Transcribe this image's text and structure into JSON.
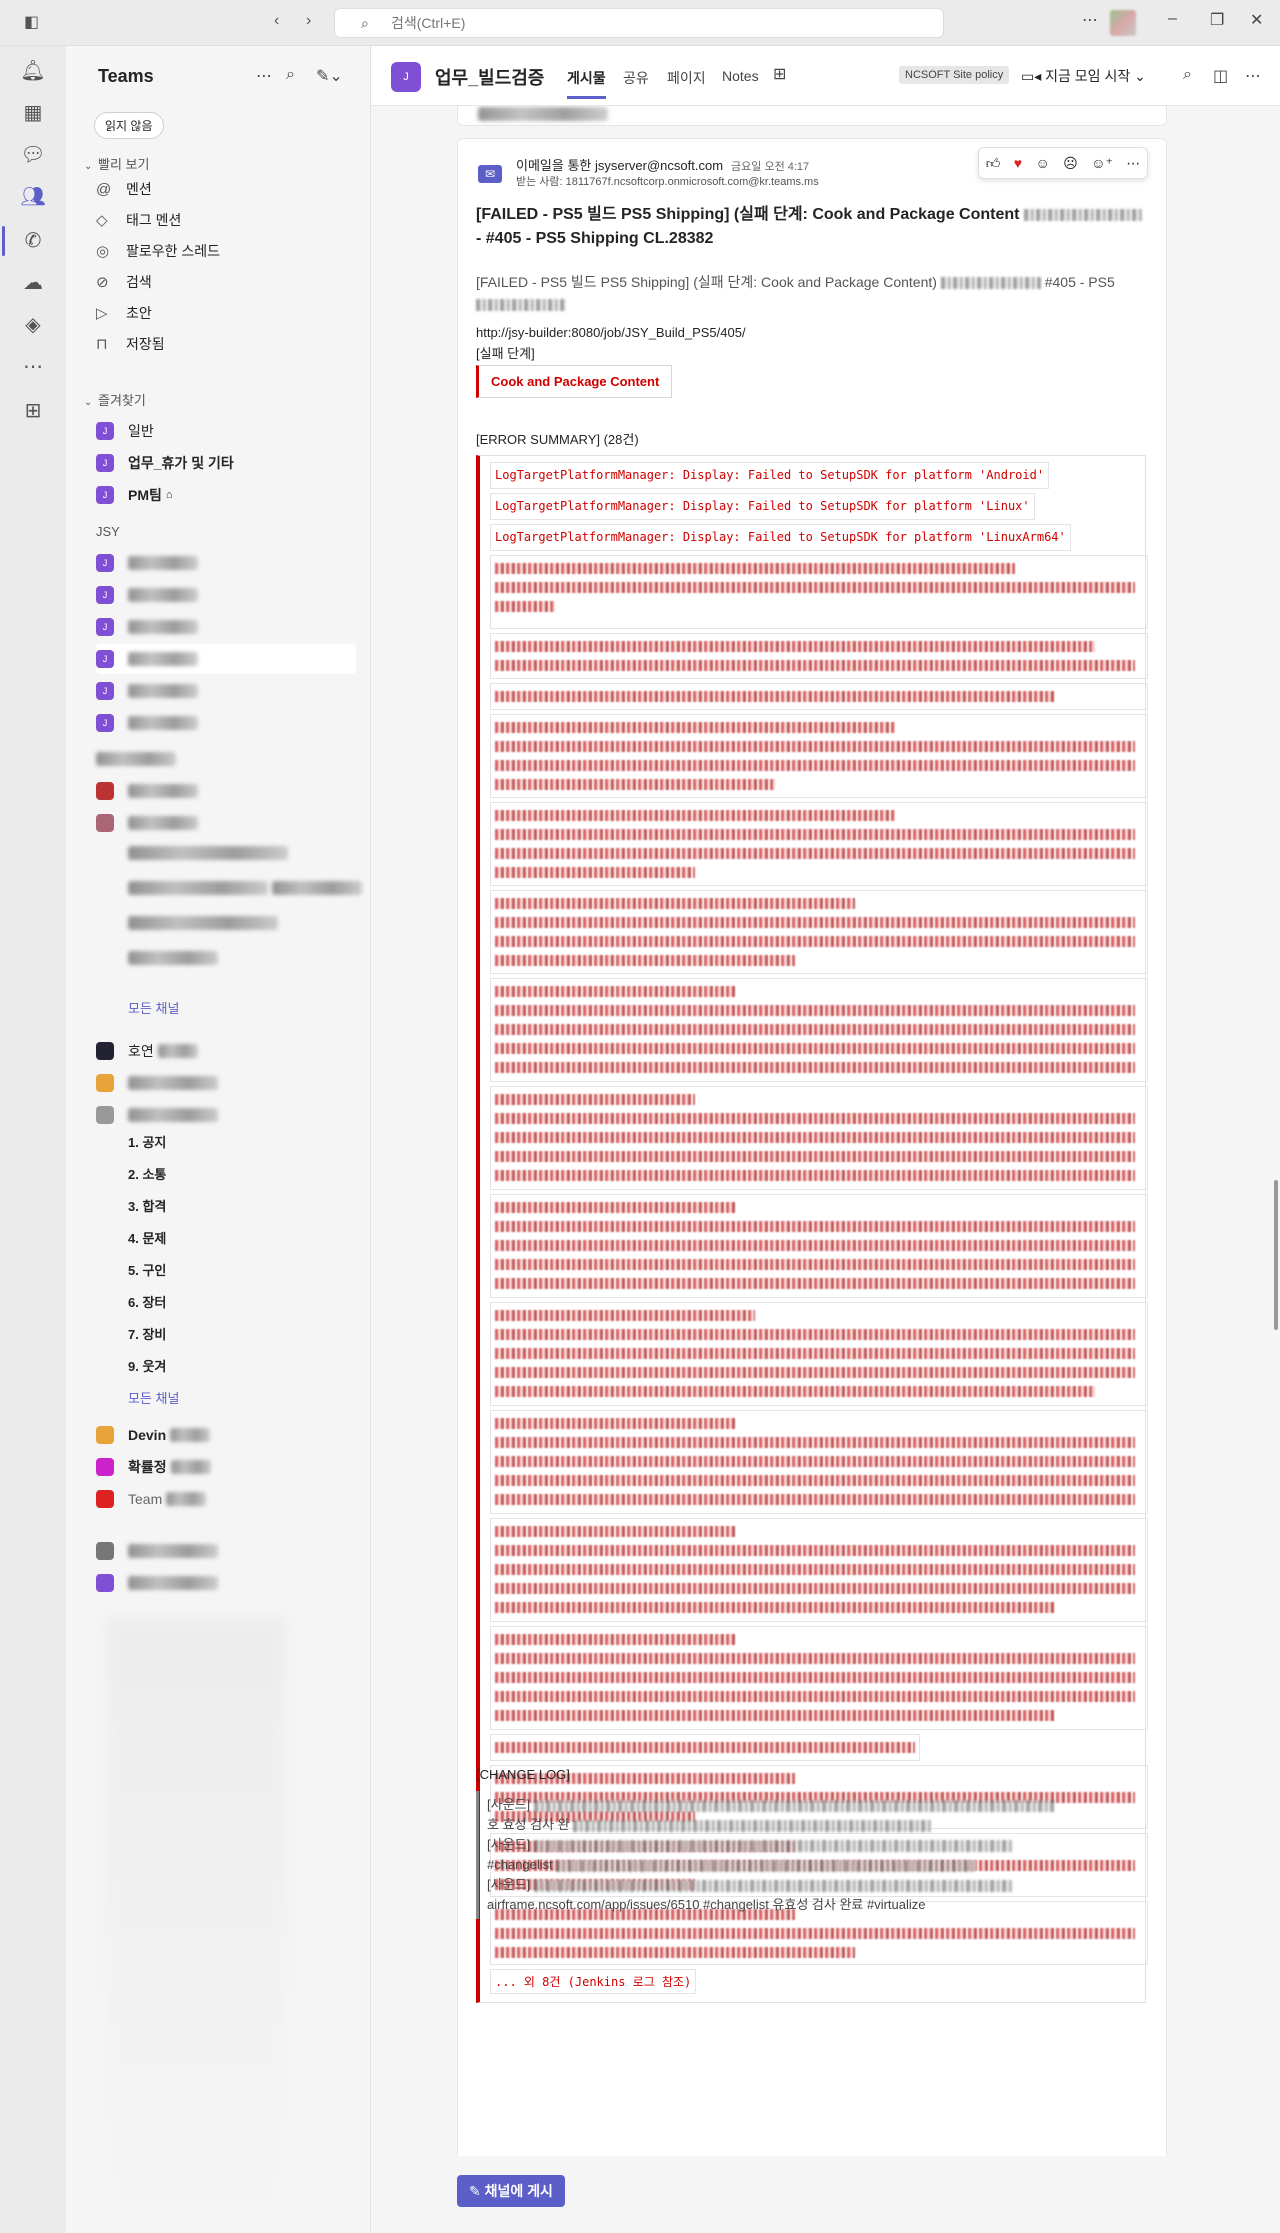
{
  "titlebar": {
    "search_placeholder": "검색(Ctrl+E)"
  },
  "sidebar": {
    "title": "Teams",
    "unread_filter": "읽지 않음",
    "quick_view": {
      "heading": "빨리 보기",
      "items": [
        {
          "label": "멘션",
          "icon": "at-icon"
        },
        {
          "label": "태그 멘션",
          "icon": "tag-icon"
        },
        {
          "label": "팔로우한 스레드",
          "icon": "thread-icon"
        },
        {
          "label": "검색",
          "icon": "search-icon"
        },
        {
          "label": "초안",
          "icon": "draft-icon"
        },
        {
          "label": "저장됨",
          "icon": "bookmark-icon"
        }
      ]
    },
    "favorites": {
      "heading": "즐겨찾기",
      "items": [
        {
          "label": "일반"
        },
        {
          "label": "업무_휴가 및 기타"
        },
        {
          "label": "PM팀"
        }
      ]
    },
    "team_jsy": {
      "heading": "JSY"
    },
    "numbered": [
      "1. 공지",
      "2. 소통",
      "3. 합격",
      "4. 문제",
      "5. 구인",
      "6. 장터",
      "7. 장비",
      "9. 웃겨"
    ],
    "more_label": "모든 채널",
    "misc": [
      "호연",
      "Devin",
      "확률정",
      "Team"
    ]
  },
  "channel": {
    "name": "업무_빌드검증",
    "tabs": [
      "게시물",
      "공유",
      "페이지",
      "Notes"
    ],
    "policy": "NCSOFT Site policy",
    "meet": "지금 모임 시작"
  },
  "post": {
    "sender": "이메일을 통한 jsyserver@ncsoft.com",
    "time": "금요일 오전 4:17",
    "recipient": "받는 사람: 1811767f.ncsoftcorp.onmicrosoft.com@kr.teams.ms",
    "subject": "[FAILED - PS5 빌드 PS5 Shipping] (실패 단계: Cook and Package Content",
    "subject2": "- #405 - PS5 Shipping CL.28382",
    "summary": "[FAILED - PS5 빌드 PS5 Shipping] (실패 단계: Cook and Package Content)",
    "summary_tail": "#405 - PS5",
    "url": "http://jsy-builder:8080/job/JSY_Build_PS5/405/",
    "stage_label": "[실패 단계]",
    "stage": "Cook and Package Content",
    "error_summary_title": "[ERROR SUMMARY] (28건)",
    "errors": [
      "LogTargetPlatformManager: Display: Failed to SetupSDK for platform 'Android'",
      "LogTargetPlatformManager: Display: Failed to SetupSDK for platform 'Linux'",
      "LogTargetPlatformManager: Display: Failed to SetupSDK for platform 'LinuxArm64'"
    ],
    "more_errors": "... 외 8건 (Jenkins 로그 참조)",
    "changelog_title": "[CHANGE LOG]",
    "changelog": [
      "[사운드]",
      "호 효성 검사 완",
      "[사운드]",
      "#changelist",
      "[사운드]",
      "airframe.ncsoft.com/app/issues/6510 #changelist 유효성 검사 완료 #virtualize"
    ]
  },
  "post_button": "채널에 게시"
}
